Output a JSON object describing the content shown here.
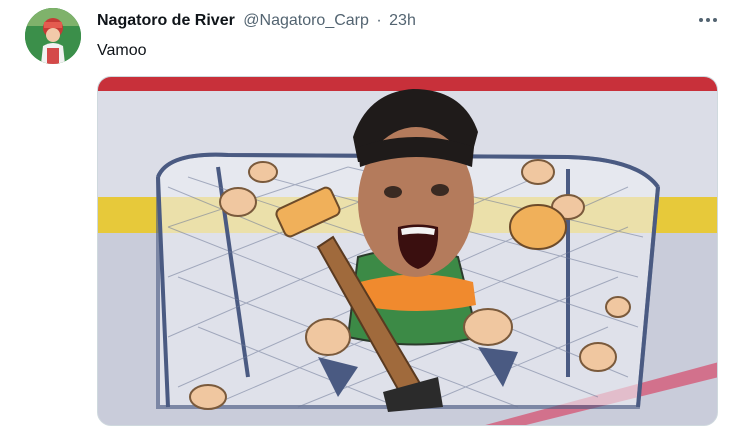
{
  "tweet": {
    "display_name": "Nagatoro de River",
    "handle": "@Nagatoro_Carp",
    "separator": "·",
    "time": "23h",
    "text": "Vamoo"
  },
  "icons": {
    "more": "more-options-icon",
    "avatar": "profile-avatar"
  },
  "colors": {
    "text_primary": "#0f1419",
    "text_secondary": "#536471",
    "rink_line_red": "#c8303a",
    "rink_line_yellow": "#e7c93a"
  }
}
